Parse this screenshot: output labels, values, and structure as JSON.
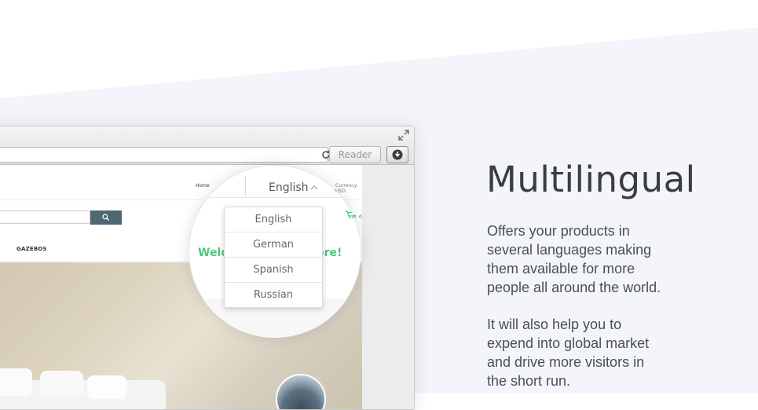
{
  "headline": "Multilingual",
  "paragraphs": {
    "p1_lines": [
      "Offers your products in",
      "several languages making",
      "them available for more",
      "people all around the world."
    ],
    "p2_lines": [
      "It will also help you to",
      "expend into global market",
      "and drive more visitors in",
      "the short run."
    ]
  },
  "browser": {
    "reader_label": "Reader"
  },
  "site": {
    "nav_home": "Home",
    "nav_currency": "Currency: USD",
    "nav_gazebos": "GAZEBOS",
    "cart_count": "0"
  },
  "magnifier": {
    "partial_text": "h",
    "selected_language": "English",
    "currency_partial": "urrency: USD",
    "welcome_partial": "Welco",
    "welcome_end": "ore!",
    "cart_count": "0"
  },
  "language_dropdown": {
    "options": [
      "English",
      "German",
      "Spanish",
      "Russian"
    ]
  },
  "colors": {
    "accent_green": "#4cc77d",
    "search_button": "#4f6675",
    "background_shape": "#f4f5fb"
  },
  "icons": [
    "expand-icon",
    "reload-icon",
    "download-icon",
    "search-icon",
    "cart-icon",
    "chevron-up-icon",
    "chevron-down-icon"
  ]
}
